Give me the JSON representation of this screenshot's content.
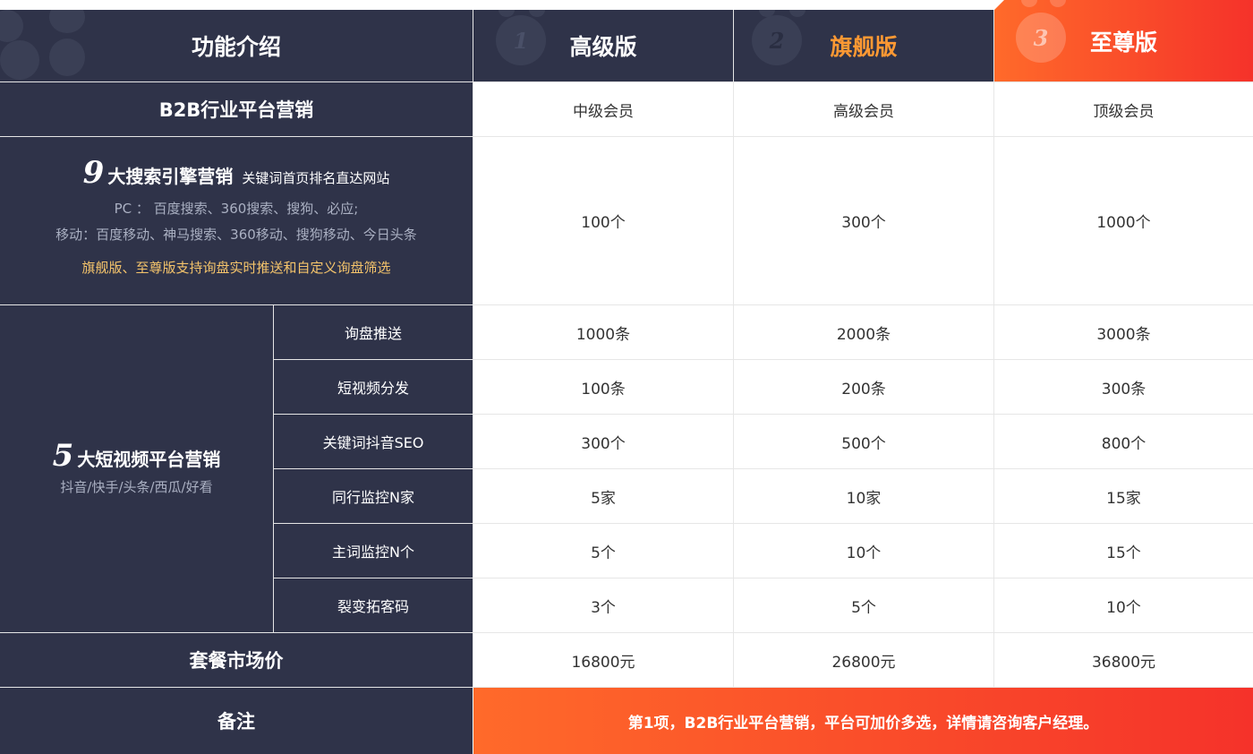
{
  "header": {
    "feature_label": "功能介绍",
    "plans": [
      {
        "num": "1",
        "name": "高级版"
      },
      {
        "num": "2",
        "name": "旗舰版"
      },
      {
        "num": "3",
        "name": "至尊版"
      }
    ]
  },
  "rows": {
    "b2b": {
      "label": "B2B行业平台营销",
      "values": [
        "中级会员",
        "高级会员",
        "顶级会员"
      ]
    },
    "search": {
      "big_num": "9",
      "title": "大搜索引擎营销",
      "tagline": "关键词首页排名直达网站",
      "pc_line": "PC ： 百度搜索、360搜索、搜狗、必应;",
      "mobile_line": "移动：百度移动、神马搜索、360移动、搜狗移动、今日头条",
      "note": "旗舰版、至尊版支持询盘实时推送和自定义询盘筛选",
      "values": [
        "100个",
        "300个",
        "1000个"
      ]
    },
    "video": {
      "big_num": "5",
      "title": "大短视频平台营销",
      "platforms": "抖音/快手/头条/西瓜/好看",
      "items": [
        {
          "label": "询盘推送",
          "values": [
            "1000条",
            "2000条",
            "3000条"
          ]
        },
        {
          "label": "短视频分发",
          "values": [
            "100条",
            "200条",
            "300条"
          ]
        },
        {
          "label": "关键词抖音SEO",
          "values": [
            "300个",
            "500个",
            "800个"
          ]
        },
        {
          "label": "同行监控N家",
          "values": [
            "5家",
            "10家",
            "15家"
          ]
        },
        {
          "label": "主词监控N个",
          "values": [
            "5个",
            "10个",
            "15个"
          ]
        },
        {
          "label": "裂变拓客码",
          "values": [
            "3个",
            "5个",
            "10个"
          ]
        }
      ]
    },
    "price": {
      "label": "套餐市场价",
      "values": [
        "16800元",
        "26800元",
        "36800元"
      ]
    },
    "remark": {
      "label": "备注",
      "text": "第1项，B2B行业平台营销，平台可加价多选，详情请咨询客户经理。"
    }
  },
  "colors": {
    "dark": "#2f3349",
    "orange_gradient_start": "#ff6a2a",
    "orange_gradient_end": "#f5322a",
    "note_yellow": "#f5c46b",
    "flagship_orange": "#ff9933"
  }
}
